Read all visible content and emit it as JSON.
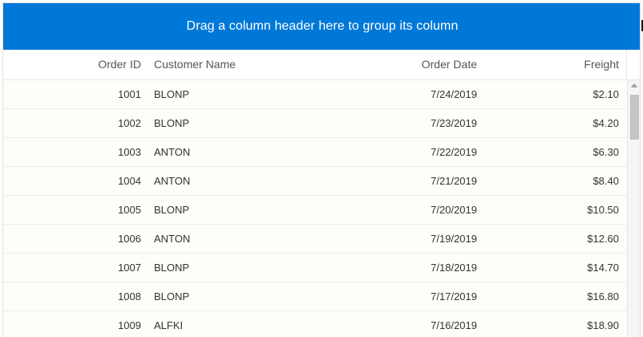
{
  "group_bar": {
    "text": "Drag a column header here to group its column"
  },
  "columns": {
    "order_id": "Order ID",
    "customer_name": "Customer Name",
    "order_date": "Order Date",
    "freight": "Freight"
  },
  "rows": [
    {
      "order_id": "1001",
      "customer": "BLONP",
      "date": "7/24/2019",
      "freight": "$2.10"
    },
    {
      "order_id": "1002",
      "customer": "BLONP",
      "date": "7/23/2019",
      "freight": "$4.20"
    },
    {
      "order_id": "1003",
      "customer": "ANTON",
      "date": "7/22/2019",
      "freight": "$6.30"
    },
    {
      "order_id": "1004",
      "customer": "ANTON",
      "date": "7/21/2019",
      "freight": "$8.40"
    },
    {
      "order_id": "1005",
      "customer": "BLONP",
      "date": "7/20/2019",
      "freight": "$10.50"
    },
    {
      "order_id": "1006",
      "customer": "ANTON",
      "date": "7/19/2019",
      "freight": "$12.60"
    },
    {
      "order_id": "1007",
      "customer": "BLONP",
      "date": "7/18/2019",
      "freight": "$14.70"
    },
    {
      "order_id": "1008",
      "customer": "BLONP",
      "date": "7/17/2019",
      "freight": "$16.80"
    },
    {
      "order_id": "1009",
      "customer": "ALFKI",
      "date": "7/16/2019",
      "freight": "$18.90"
    }
  ],
  "colors": {
    "group_bar_bg": "#0078d7",
    "row_bg": "#fdfdf9"
  },
  "scrollbar": {
    "position_fraction": 0.0
  }
}
